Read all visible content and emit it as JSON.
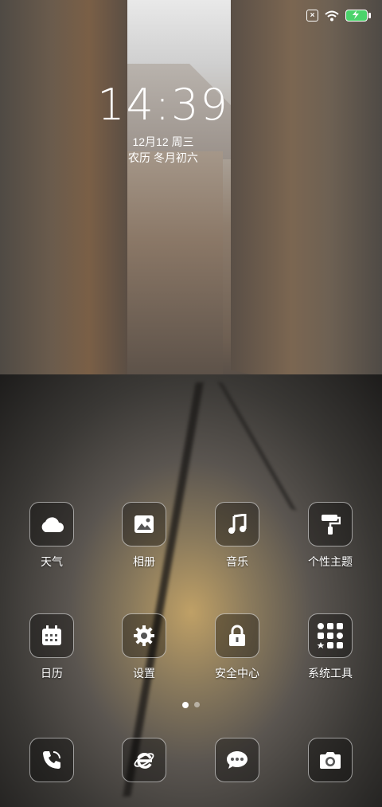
{
  "status_bar": {
    "icons": [
      "sim-no-signal-icon",
      "wifi-icon",
      "battery-charging-icon"
    ],
    "battery_color": "#4bd36b"
  },
  "lock": {
    "time": "14:39",
    "date": "12月12 周三",
    "lunar": "农历 冬月初六"
  },
  "apps": [
    {
      "label": "天气",
      "icon": "cloud-icon"
    },
    {
      "label": "相册",
      "icon": "gallery-icon"
    },
    {
      "label": "音乐",
      "icon": "music-icon"
    },
    {
      "label": "个性主题",
      "icon": "paint-roller-icon"
    },
    {
      "label": "日历",
      "icon": "calendar-icon"
    },
    {
      "label": "设置",
      "icon": "gear-icon"
    },
    {
      "label": "安全中心",
      "icon": "lock-icon"
    },
    {
      "label": "系统工具",
      "icon": "tools-folder-icon"
    }
  ],
  "page_indicator": {
    "current": 1,
    "total": 2
  },
  "dock": [
    {
      "name": "phone",
      "icon": "phone-icon"
    },
    {
      "name": "browser",
      "icon": "browser-icon"
    },
    {
      "name": "messages",
      "icon": "message-icon"
    },
    {
      "name": "camera",
      "icon": "camera-icon"
    }
  ]
}
